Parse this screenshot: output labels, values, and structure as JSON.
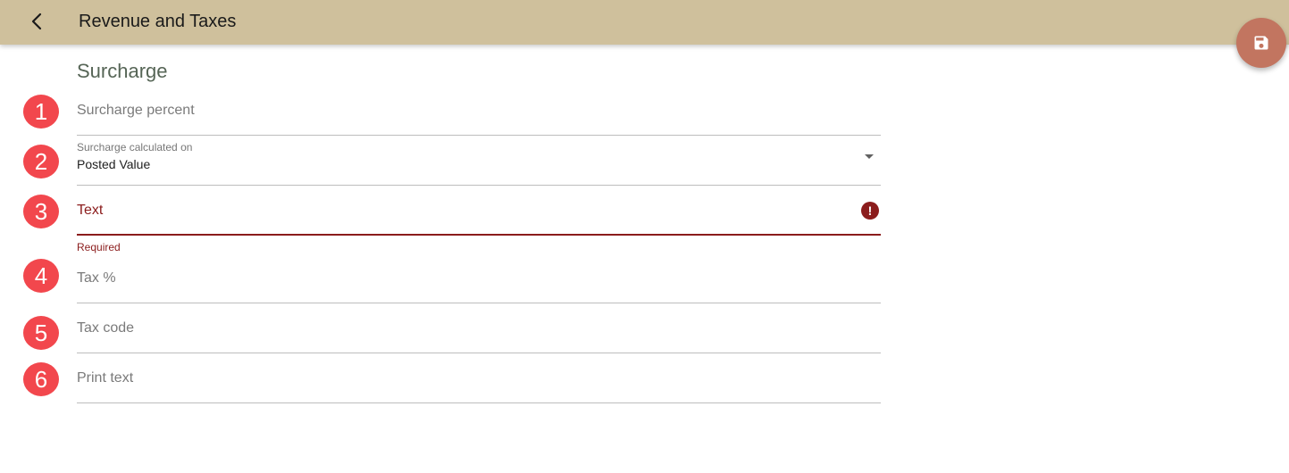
{
  "app": {
    "title": "Revenue and Taxes",
    "back_icon": "arrow-back-icon",
    "save_icon": "save-icon"
  },
  "colors": {
    "appbar": "#cfc09c",
    "fab": "#c27560",
    "badge": "#f2474d",
    "error": "#8b1c1c",
    "section_title": "#566556"
  },
  "section": {
    "title": "Surcharge"
  },
  "fields": [
    {
      "number": "1",
      "placeholder": "Surcharge percent"
    },
    {
      "number": "2",
      "label": "Surcharge calculated on",
      "value": "Posted Value"
    },
    {
      "number": "3",
      "placeholder": "Text",
      "helper": "Required",
      "error_icon": "!"
    },
    {
      "number": "4",
      "placeholder": "Tax %"
    },
    {
      "number": "5",
      "placeholder": "Tax code"
    },
    {
      "number": "6",
      "placeholder": "Print text"
    }
  ]
}
